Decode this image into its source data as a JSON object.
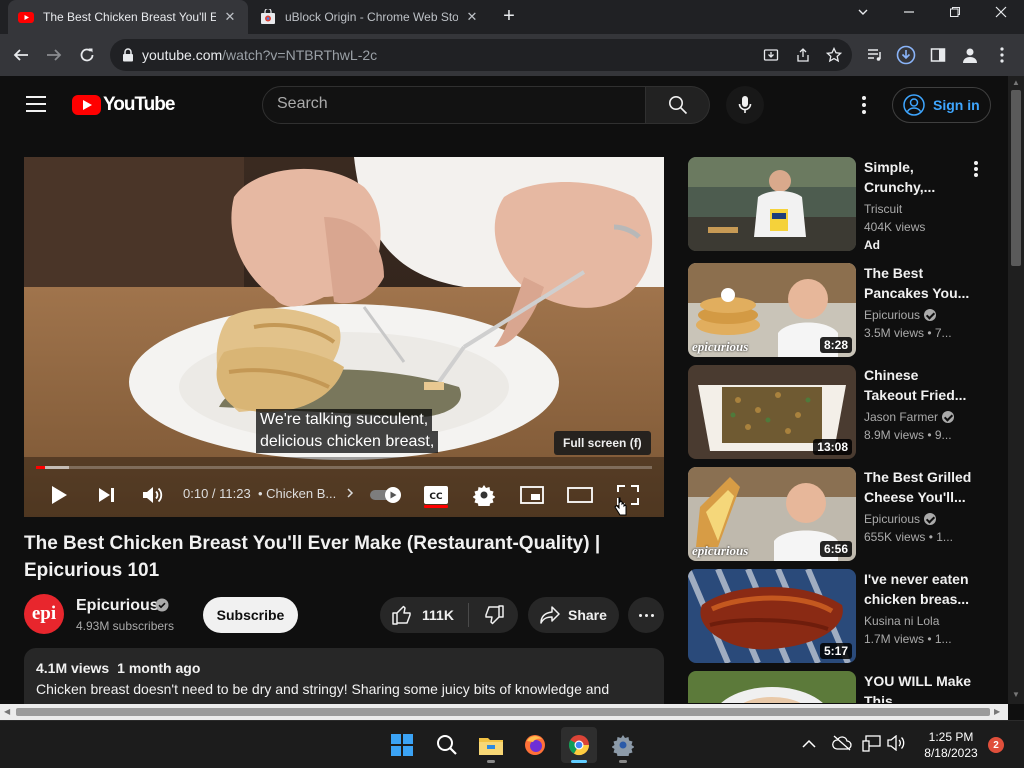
{
  "browser": {
    "tabs": [
      {
        "title": "The Best Chicken Breast You'll Ever Make (Restaurant-Quality) | Epicurious 101 - YouTube",
        "icon": "youtube-icon",
        "active": true
      },
      {
        "title": "uBlock Origin - Chrome Web Store",
        "icon": "chrome-web-store-icon",
        "active": false
      }
    ],
    "url_domain": "youtube.com",
    "url_path": "/watch?v=NTBRThwL-2c"
  },
  "header": {
    "logo_text": "YouTube",
    "search_placeholder": "Search",
    "signin_label": "Sign in"
  },
  "player": {
    "caption_lines": [
      "We're talking succulent,",
      "delicious chicken breast,"
    ],
    "fullscreen_tooltip": "Full screen (f)",
    "time": "0:10 / 11:23",
    "chapter": "• Chicken B...",
    "progress_fraction": 0.015,
    "buffered_fraction": 0.054
  },
  "video": {
    "title": "The Best Chicken Breast You'll Ever Make (Restaurant-Quality) | Epicurious 101",
    "channel_name": "Epicurious",
    "channel_avatar_text": "epi",
    "subscribers": "4.93M subscribers",
    "subscribe_label": "Subscribe",
    "likes": "111K",
    "share_label": "Share",
    "views": "4.1M views",
    "age": "1 month ago",
    "description": "Chicken breast doesn't need to be dry and stringy! Sharing some juicy bits of knowledge and"
  },
  "recommendations": [
    {
      "title": "Simple, Crunchy,...",
      "channel": "Triscuit",
      "meta": "404K views",
      "badge": "Ad",
      "duration": "",
      "verified": false
    },
    {
      "title": "The Best Pancakes You...",
      "channel": "Epicurious",
      "meta": "3.5M views • 7...",
      "badge": "",
      "duration": "8:28",
      "verified": true,
      "watermark": "epicurious"
    },
    {
      "title": "Chinese Takeout Fried...",
      "channel": "Jason Farmer",
      "meta": "8.9M views • 9...",
      "badge": "",
      "duration": "13:08",
      "verified": true
    },
    {
      "title": "The Best Grilled Cheese You'll...",
      "channel": "Epicurious",
      "meta": "655K views • 1...",
      "badge": "",
      "duration": "6:56",
      "verified": true,
      "watermark": "epicurious"
    },
    {
      "title": "I've never eaten chicken breas...",
      "channel": "Kusina ni Lola",
      "meta": "1.7M views • 1...",
      "badge": "",
      "duration": "5:17",
      "verified": false
    },
    {
      "title": "YOU WILL Make This...",
      "channel": "",
      "meta": "",
      "badge": "",
      "duration": "",
      "verified": false
    }
  ],
  "taskbar": {
    "apps": [
      "windows-start-icon",
      "search-icon",
      "file-explorer-icon",
      "firefox-icon",
      "chrome-icon",
      "settings-icon"
    ],
    "time": "1:25 PM",
    "date": "8/18/2023",
    "notification_count": "2"
  },
  "colors": {
    "youtube_red": "#ff0000",
    "link_blue": "#3ea6ff",
    "background": "#0f0f0f"
  }
}
